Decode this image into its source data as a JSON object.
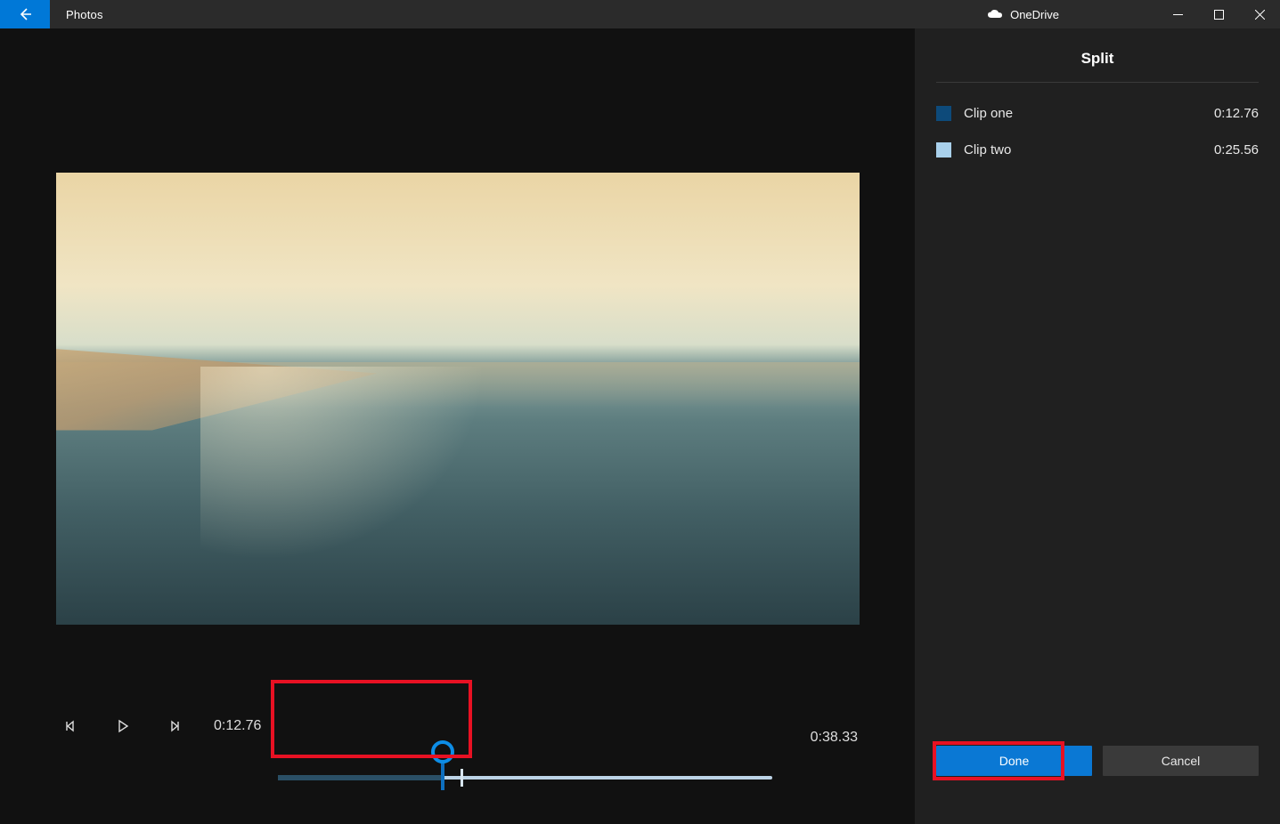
{
  "titlebar": {
    "app_name": "Photos",
    "service_label": "OneDrive"
  },
  "panel": {
    "title": "Split",
    "clips": [
      {
        "label": "Clip one",
        "duration": "0:12.76",
        "swatch": "dark"
      },
      {
        "label": "Clip two",
        "duration": "0:25.56",
        "swatch": "light"
      }
    ],
    "done_label": "Done",
    "cancel_label": "Cancel"
  },
  "player": {
    "current_time": "0:12.76",
    "total_time": "0:38.33",
    "split_fraction": 0.333
  }
}
